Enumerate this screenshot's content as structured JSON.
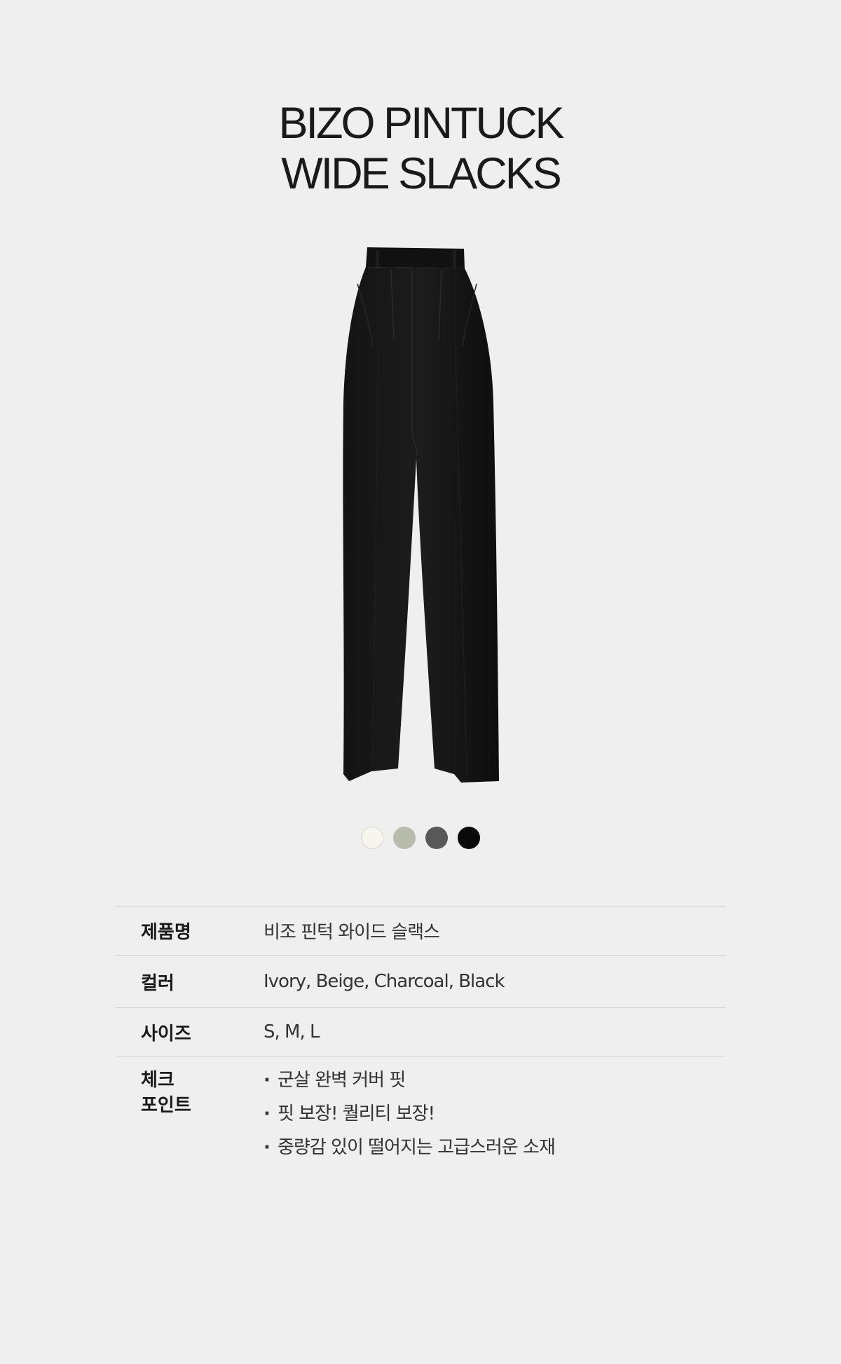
{
  "product": {
    "title_line1": "BIZO PINTUCK",
    "title_line2": "WIDE SLACKS"
  },
  "colors": {
    "background": "#efefef",
    "swatches": [
      {
        "name": "Ivory",
        "hex": "#f7f5ee"
      },
      {
        "name": "Beige",
        "hex": "#b7bcac"
      },
      {
        "name": "Charcoal",
        "hex": "#595959"
      },
      {
        "name": "Black",
        "hex": "#0a0a0a"
      }
    ]
  },
  "info": {
    "name_label": "제품명",
    "name_value": "비조 핀턱 와이드 슬랙스",
    "color_label": "컬러",
    "color_value": "Ivory, Beige, Charcoal, Black",
    "size_label": "사이즈",
    "size_value": "S, M, L",
    "check_label_line1": "체크",
    "check_label_line2": "포인트",
    "check_points": [
      "군살 완벽 커버 핏",
      "핏 보장! 퀄리티 보장!",
      "중량감 있이 떨어지는 고급스러운 소재"
    ]
  }
}
